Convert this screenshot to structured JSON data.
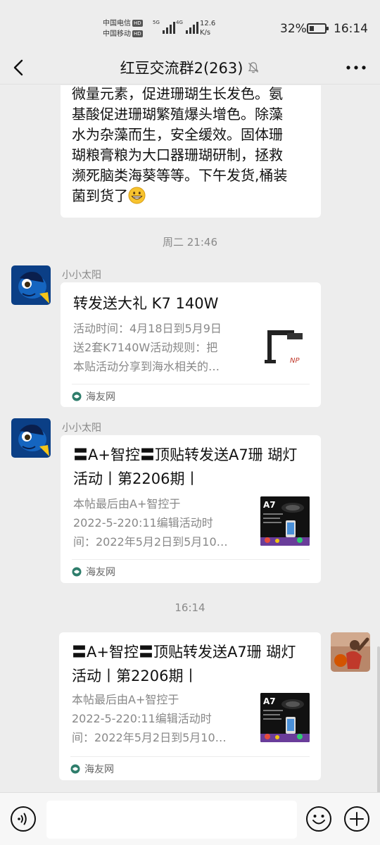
{
  "status_bar": {
    "carrier_1": "中国电信",
    "carrier_2": "中国移动",
    "hd": "HD",
    "net_1": "5G",
    "net_2": "4G",
    "speed_value": "12.6",
    "speed_unit": "K/s",
    "battery_percent": "32%",
    "battery_level": 0.32,
    "time": "16:14"
  },
  "header": {
    "title": "红豆交流群2(263)"
  },
  "messages": [
    {
      "type": "text",
      "text": "微量元素，促进珊瑚生长发色。氨基酸促进珊瑚繁殖爆头增色。除藻水为杂藻而生，安全缓效。固体珊瑚粮膏粮为大口器珊瑚研制，拯救濒死脑类海葵等等。下午发货,桶装菌到货了",
      "line_1": "微量元素，促进珊瑚生长发色。氨",
      "line_2": "基酸促进珊瑚繁殖爆头增色。除藻",
      "line_3": "水为杂藻而生，安全缓效。固体珊",
      "line_4": "瑚粮膏粮为大口器珊瑚研制，拯救",
      "line_5": "濒死脑类海葵等等。下午发货,桶装",
      "line_6": "菌到货了"
    },
    {
      "type": "time",
      "text": "周二 21:46"
    },
    {
      "type": "card",
      "sender": "小小太阳",
      "title": "转发送大礼 K7 140W",
      "desc_1": "活动时间：4月18日到5月9日",
      "desc_2": "送2套K7140W活动规则：把",
      "desc_3": "本贴活动分享到海水相关的…",
      "source": "海友网",
      "thumb_caption": "NP"
    },
    {
      "type": "card",
      "sender": "小小太阳",
      "title_1": "〓A+智控〓顶贴转发送A7珊 瑚灯",
      "title_2": "活动丨第2206期丨",
      "desc_1": "本帖最后由A+智控于",
      "desc_2": "2022-5-220:11编辑活动时",
      "desc_3": "间：2022年5月2日到5月10…",
      "source": "海友网",
      "thumb_caption": "A7"
    },
    {
      "type": "time",
      "text": "16:14"
    },
    {
      "type": "card",
      "sender": "",
      "title_1": "〓A+智控〓顶贴转发送A7珊 瑚灯",
      "title_2": "活动丨第2206期丨",
      "desc_1": "本帖最后由A+智控于",
      "desc_2": "2022-5-220:11编辑活动时",
      "desc_3": "间：2022年5月2日到5月10…",
      "source": "海友网",
      "thumb_caption": "A7"
    }
  ],
  "input_bar": {
    "placeholder": "",
    "icons": [
      "voice-icon",
      "emoji-icon",
      "plus-icon"
    ]
  },
  "colors": {
    "background": "#ededed",
    "bubble": "#ffffff",
    "muted_text": "#888888"
  }
}
